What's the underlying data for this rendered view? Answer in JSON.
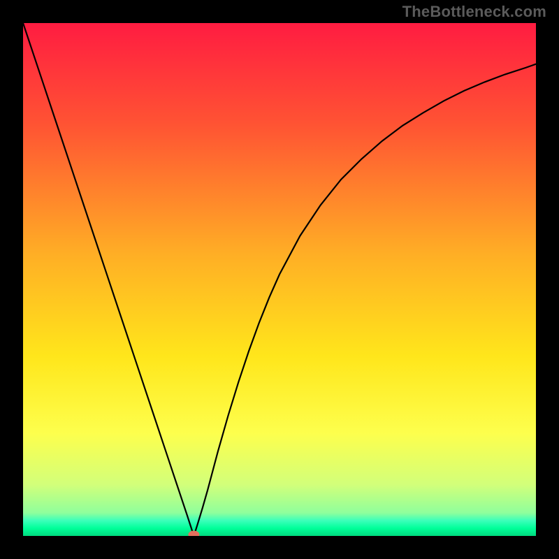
{
  "watermark": "TheBottleneck.com",
  "chart_data": {
    "type": "line",
    "title": "",
    "xlabel": "",
    "ylabel": "",
    "xlim": [
      0,
      1
    ],
    "ylim": [
      0,
      1
    ],
    "background_gradient_stops": [
      {
        "offset": 0.0,
        "color": "#ff1c41"
      },
      {
        "offset": 0.2,
        "color": "#ff5433"
      },
      {
        "offset": 0.45,
        "color": "#ffae25"
      },
      {
        "offset": 0.65,
        "color": "#ffe61b"
      },
      {
        "offset": 0.8,
        "color": "#fdff4d"
      },
      {
        "offset": 0.9,
        "color": "#d2ff7a"
      },
      {
        "offset": 0.955,
        "color": "#8fff9c"
      },
      {
        "offset": 0.97,
        "color": "#3bffba"
      },
      {
        "offset": 0.985,
        "color": "#00ff99"
      },
      {
        "offset": 1.0,
        "color": "#00d97e"
      }
    ],
    "series": [
      {
        "name": "bottleneck-curve",
        "color": "#000000",
        "stroke_width": 2.2,
        "x": [
          0.0,
          0.02,
          0.04,
          0.06,
          0.08,
          0.1,
          0.12,
          0.14,
          0.16,
          0.18,
          0.2,
          0.22,
          0.24,
          0.26,
          0.28,
          0.3,
          0.32,
          0.333,
          0.34,
          0.35,
          0.36,
          0.38,
          0.4,
          0.42,
          0.44,
          0.46,
          0.48,
          0.5,
          0.54,
          0.58,
          0.62,
          0.66,
          0.7,
          0.74,
          0.78,
          0.82,
          0.86,
          0.9,
          0.94,
          0.98,
          1.0
        ],
        "y": [
          1.0,
          0.94,
          0.88,
          0.82,
          0.76,
          0.7,
          0.64,
          0.58,
          0.52,
          0.46,
          0.4,
          0.34,
          0.28,
          0.22,
          0.16,
          0.1,
          0.04,
          0.0,
          0.022,
          0.055,
          0.09,
          0.165,
          0.235,
          0.3,
          0.36,
          0.415,
          0.465,
          0.51,
          0.585,
          0.645,
          0.695,
          0.735,
          0.77,
          0.8,
          0.825,
          0.848,
          0.868,
          0.885,
          0.9,
          0.913,
          0.92
        ]
      }
    ],
    "marker": {
      "name": "minimum-point",
      "x": 0.333,
      "y": 0.0,
      "color": "#e2705e",
      "rx": 8,
      "ry": 5.5
    },
    "grid": false,
    "legend": false
  }
}
